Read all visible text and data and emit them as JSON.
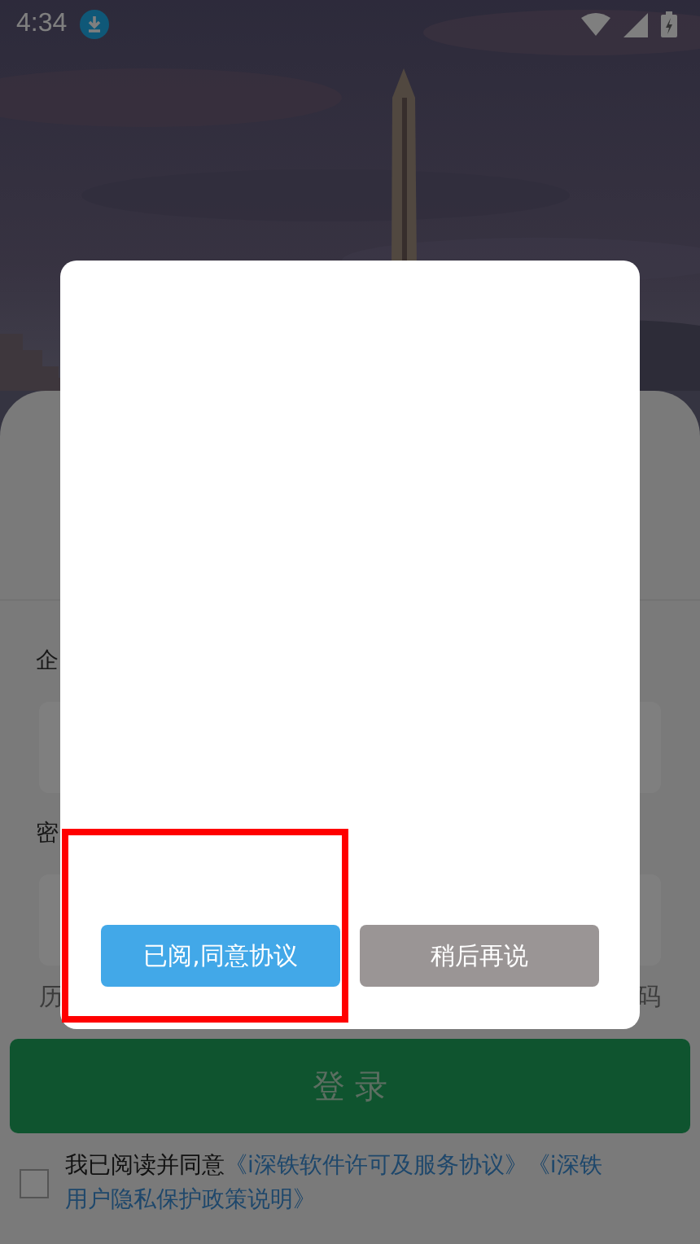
{
  "status_bar": {
    "time": "4:34"
  },
  "login_form": {
    "company_label": "企",
    "password_label": "密",
    "history_hint": "历",
    "forgot_hint": "码",
    "login_button": "登 录",
    "agreement": {
      "checked": false,
      "intro": "我已阅读并同意",
      "links": [
        "《i深铁软件许可及服务协议》",
        "《i深铁用户隐私保护政策说明》"
      ]
    }
  },
  "dialog": {
    "buttons": [
      {
        "kind": "primary",
        "label": "已阅,同意协议"
      },
      {
        "kind": "secondary",
        "label": "稍后再说"
      }
    ]
  },
  "annotation": {
    "kind": "frame",
    "color": "#ff0000"
  }
}
